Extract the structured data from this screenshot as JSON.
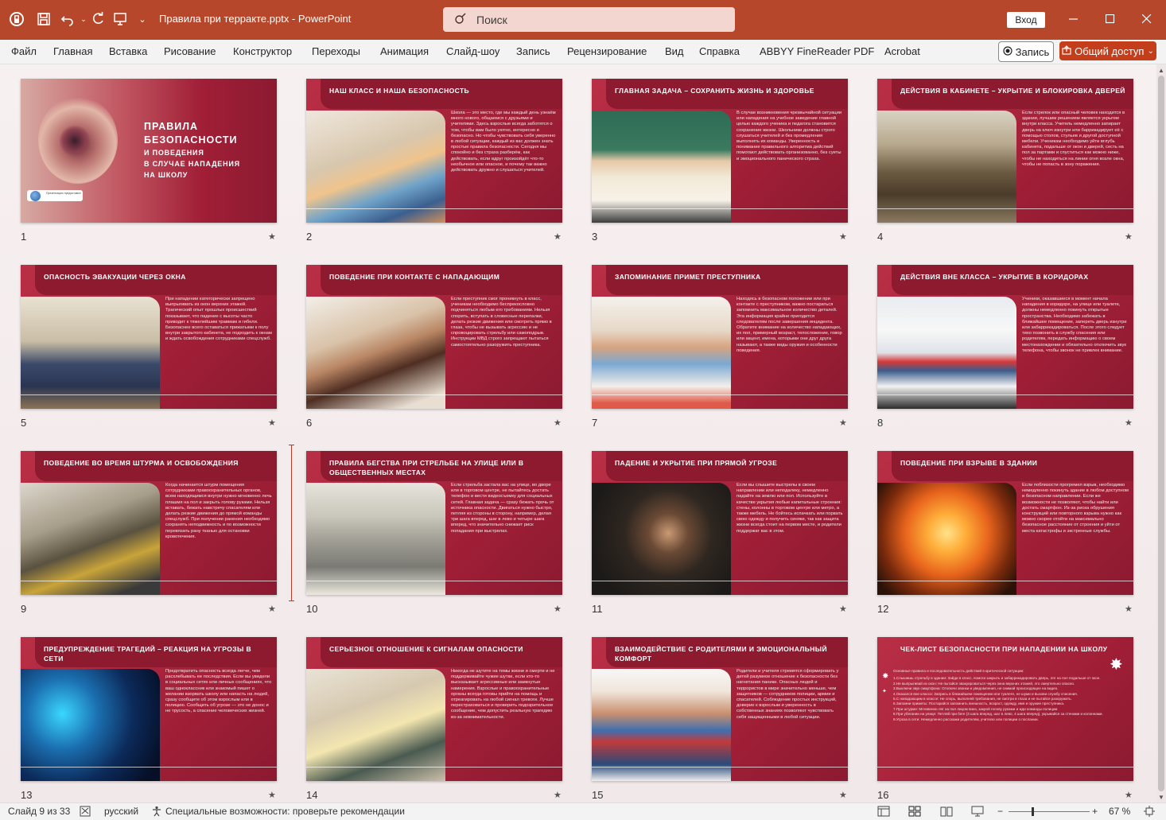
{
  "app": {
    "title": "Правила при терракте.pptx  -  PowerPoint",
    "search_placeholder": "Поиск",
    "signin_label": "Вход",
    "accent": "#b7472a"
  },
  "menu": {
    "items": [
      "Файл",
      "Главная",
      "Вставка",
      "Рисование",
      "Конструктор",
      "Переходы",
      "Анимация",
      "Слайд-шоу",
      "Запись",
      "Рецензирование",
      "Вид",
      "Справка",
      "ABBYY FineReader PDF",
      "Acrobat"
    ],
    "record_label": "Запись",
    "share_label": "Общий доступ"
  },
  "slides": [
    {
      "num": "1",
      "title_l1": "Правила",
      "title_l2": "безопасности",
      "title_l3": "и поведения",
      "title_l4": "в случае нападения",
      "title_l5": "на школу",
      "badge": "Презентацию предоставил"
    },
    {
      "num": "2",
      "title": "Наш класс и наша безопасность",
      "body": "Школа — это место, где мы каждый день узнаём много нового, общаемся с друзьями и учителями. Здесь взрослые всегда заботятся о том, чтобы вам было уютно, интересно и безопасно. Но чтобы чувствовать себя уверенно в любой ситуации, каждый из вас должен знать простые правила безопасности. Сегодня мы спокойно и без страха разберём, как действовать, если вдруг произойдёт что-то необычное или опасное, и почему так важно действовать дружно и слушаться учителей."
    },
    {
      "num": "3",
      "title": "Главная задача – сохранить жизнь и здоровье",
      "body": "В случае возникновения чрезвычайной ситуации или нападения на учебное заведение главной целью каждого ученика и педагога становится сохранение жизни. Школьники должны строго слушаться учителей и без промедления выполнять их команды. Уверенность и понимание правильного алгоритма действий помогают действовать организованно, без суеты и эмоционального панического страха."
    },
    {
      "num": "4",
      "title": "Действия в кабинете – укрытие и блокировка дверей",
      "body": "Если стрелок или опасный человек находится в здании, лучшим решением является укрытие внутри класса. Учитель немедленно запирает дверь на ключ изнутри или баррикадирует её с помощью столов, стульев и другой доступной мебели. Ученикам необходимо уйти вглубь кабинета, подальше от окон и дверей, сесть на пол за партами и спуститься как можно ниже, чтобы не находиться на линии огня возле окна, чтобы не попасть в зону поражения."
    },
    {
      "num": "5",
      "title": "Опасность эвакуации через окна",
      "body": "При нападении категорически запрещено выпрыгивать из окон верхних этажей. Трагический опыт прошлых происшествий показывает, что падение с высоты часто приводит к тяжелейшим травмам и гибели. Безопаснее всего оставаться прижатыми к полу внутри закрытого кабинета, не подходить к окнам и ждать освобождения сотрудниками спецслужб."
    },
    {
      "num": "6",
      "title": "Поведение при контакте с нападающим",
      "body": "Если преступник смог проникнуть в класс, ученикам необходимо беспрекословно подчиняться любым его требованиям. Нельзя спорить, вступать в словесные перепалки, делать резкие движения или смотреть прямо в глаза, чтобы не вызывать агрессию и не спровоцировать стрельбу или самоподрыв. Инструкции МВД строго запрещают пытаться самостоятельно разоружить преступника."
    },
    {
      "num": "7",
      "title": "Запоминание примет преступника",
      "body": "Находясь в безопасном положении или при контакте с преступником, важно постараться запомнить максимальное количество деталей. Эта информация крайне пригодится следователям после завершения инцидента. Обратите внимание на количество нападающих, их пол, примерный возраст, телосложение, говор или акцент, имена, которыми они друг друга называют, а также виды оружия и особенности поведения."
    },
    {
      "num": "8",
      "title": "Действия вне класса – укрытие в коридорах",
      "body": "Ученики, оказавшиеся в момент начала нападения в коридоре, на улице или туалете, должны немедленно покинуть открытые пространства. Необходимо забежать в ближайшее помещение, запереть дверь изнутри или забаррикадироваться. После этого следует тихо позвонить в службу спасения или родителям, передать информацию о своем местонахождении и обязательно отключить звук телефона, чтобы звонок не привлек внимание."
    },
    {
      "num": "9",
      "title": "Поведение во время штурма и освобождения",
      "body": "Когда начинается штурм помещения сотрудниками правоохранительных органов, всем находящимся внутри нужно мгновенно лечь плашмя на пол и закрыть голову руками. Нельзя вставать, бежать навстречу спасателям или делать резкие движения до прямой команды спецслужб. При получении ранения необходимо сохранять неподвижность и по возможности перевязать рану тканью для остановки кровотечения."
    },
    {
      "num": "10",
      "title": "Правила бегства при стрельбе на улице или в общественных местах",
      "body": "Если стрельба застала вас на улице, во дворе или в торговом центре, не пытайтесь достать телефон и вести видеосъемку для социальных сетей. Главная задача — сразу бежать прочь от источника опасности. Двигаться нужно быстро, петляя из стороны в сторону, например, делая три шага вперед, шаг в лево и четыре шага вперед, что значительно снижает риск попадания при выстрелах."
    },
    {
      "num": "11",
      "title": "Падение и укрытие при прямой угрозе",
      "body": "Если вы слышите выстрелы в своем направлении или неподалеку, немедленно падайте на землю или пол. Используйте в качестве укрытия любые капитальные строения: стены, колонны в торговом центре или метро, а также мебель. Не бойтесь испачкать или порвать свою одежду и получить синяки, так как защита жизни всегда стоит на первом месте, и родители поддержат вас в этом."
    },
    {
      "num": "12",
      "title": "Поведение при взрыве в здании",
      "body": "Если поблизости прогремел взрыв, необходимо немедленно покинуть здание в любом доступном и безопасном направлении. Если же возможности не позволяют, чтобы найти или достать смартфон. Из-за риска обрушения конструкций или повторного взрыва нужно как можно скорее отойти на максимально безопасное расстояние от строения и уйти от места катастрофы и экстренные службы."
    },
    {
      "num": "13",
      "title": "Предупреждение трагедий – реакция на угрозы в сети",
      "body": "Предотвратить опасность всегда легче, чем расхлебывать ее последствия. Если вы увидели в социальных сетях или личных сообщениях, что ваш одноклассник или знакомый пишет о желании взорвать школу или напасть на людей, сразу сообщите об этом взрослым или в полицию. Сообщить об угрозе — это не донос и не трусость, а спасение человеческих жизней."
    },
    {
      "num": "14",
      "title": "Серьезное отношение к сигналам опасности",
      "body": "Никогда не шутите на темы жизни и смерти и не поддерживайте чужие шутки, если кто-то высказывает агрессивные или замкнутые намерения. Взрослые и правоохранительные органы всегда готовы прийти на помощь и отреагировать на любой сигнал тревоги. Лучше перестраховаться и проверить подозрительное сообщение, чем допустить реальную трагедию из-за невнимательности."
    },
    {
      "num": "15",
      "title": "Взаимодействие с родителями и эмоциональный комфорт",
      "body": "Родители и учителя стремятся сформировать у детей разумное отношение к безопасности без нагнетания паники. Опасных людей и террористов в мире значительно меньше, чем защитников — сотрудников полиции, армии и спасателей. Соблюдение простых инструкций, доверие к взрослым и уверенность в собственных знаниях позволяют чувствовать себя защищенными в любой ситуации."
    },
    {
      "num": "16",
      "title": "Чек-лист безопасности при нападении на школу",
      "intro": "Основные правила и последовательность действий в критической ситуации:",
      "items": [
        "1.Слышишь стрельбу в здании: Зайди в класс, помоги закрыть и забаррикадировать дверь, ляг на пол подальше от окон.",
        "2.Не выпрыгивай из окон: Не пытайся эвакуироваться через окна верхних этажей, это смертельно опасно.",
        "3.Выключи звук смартфона: Отключи звонки и уведомления, не снимай происходящее на видео.",
        "4.Оказался вне класса: Запрись в ближайшем помещении или туалете, не шуми и вызови службу спасения.",
        "5.С нападающим в классе: Не спорь, выполняй требования, не смотри в глаза и не пытайся разоружить.",
        "6.Запомни приметы: Постарайся запомнить внешность, возраст, одежду, имя и оружие преступника.",
        "7.При штурме: Мгновенно ляг на пол лицом вниз, закрой голову руками и жди команды полиции.",
        "8.При убегании на улице: Петляй при беге (3 шага вперед, шаг в лево, 4 шага вперед), укрывайся за стенами и колоннами.",
        "9.Угроза в сети: Немедленно расскажи родителям, учителю или полиции о послании."
      ]
    }
  ],
  "status": {
    "slide_info": "Слайд 9 из 33",
    "language": "русский",
    "accessibility": "Специальные возможности: проверьте рекомендации",
    "zoom": "67 %"
  },
  "icons": {
    "app": "powerpoint-logo-icon",
    "save": "save-icon",
    "undo": "undo-icon",
    "redo": "redo-icon",
    "present": "present-from-start-icon",
    "search": "search-icon"
  }
}
